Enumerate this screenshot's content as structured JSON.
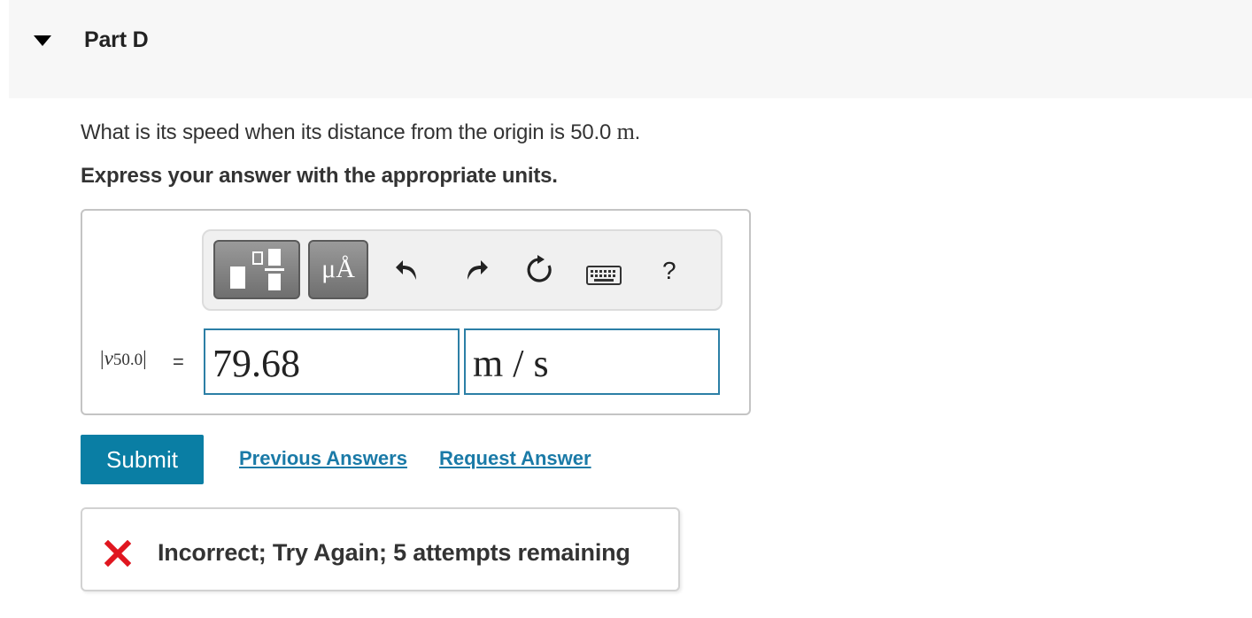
{
  "part": {
    "title": "Part D",
    "collapse_icon": "caret-down-icon"
  },
  "question": {
    "text": "What is its speed when its distance from the origin is 50.0 ",
    "unit": "m",
    "end": ".",
    "instruction": "Express your answer with the appropriate units."
  },
  "toolbar": {
    "templates_icon": "fraction-template-icon",
    "units_label": "μÅ",
    "undo_icon": "undo-icon",
    "redo_icon": "redo-icon",
    "reset_icon": "reset-icon",
    "keyboard_icon": "keyboard-icon",
    "help_label": "?"
  },
  "answer": {
    "variable": "v",
    "subscript": "50.0",
    "equals": "=",
    "value": "79.68",
    "unit": "m / s"
  },
  "actions": {
    "submit_label": "Submit",
    "previous_answers_label": "Previous Answers",
    "request_answer_label": "Request Answer"
  },
  "feedback": {
    "icon": "x-icon",
    "text": "Incorrect; Try Again; 5 attempts remaining"
  },
  "colors": {
    "accent": "#0a7ea4",
    "link": "#1a7aa7",
    "field_border": "#2c7fa6",
    "error": "#e0161f",
    "header_bg": "#f7f7f7"
  }
}
